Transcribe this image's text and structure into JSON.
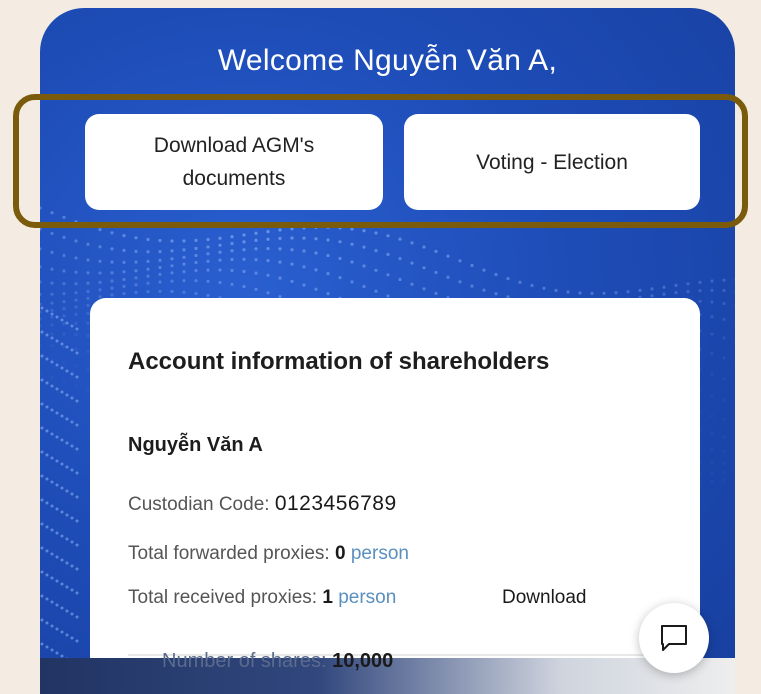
{
  "header": {
    "welcome": "Welcome Nguyễn Văn A,"
  },
  "actions": {
    "download_docs_label": "Download AGM's documents",
    "voting_label": "Voting - Election"
  },
  "account": {
    "title": "Account information of shareholders",
    "name": "Nguyễn Văn A",
    "custodian_label": "Custodian Code: ",
    "custodian_code": "0123456789",
    "forwarded_label": "Total forwarded proxies: ",
    "forwarded_value": "0",
    "received_label": "Total received proxies: ",
    "received_value": "1",
    "unit": "person",
    "download_label": "Download",
    "shares_label": "Number of shares: ",
    "shares_value": "10,000"
  },
  "icons": {
    "chat": "chat-bubble-icon"
  },
  "colors": {
    "brand_blue": "#1e4db8",
    "highlight": "#7a5a0b",
    "unit_blue": "#5a8fbf"
  }
}
